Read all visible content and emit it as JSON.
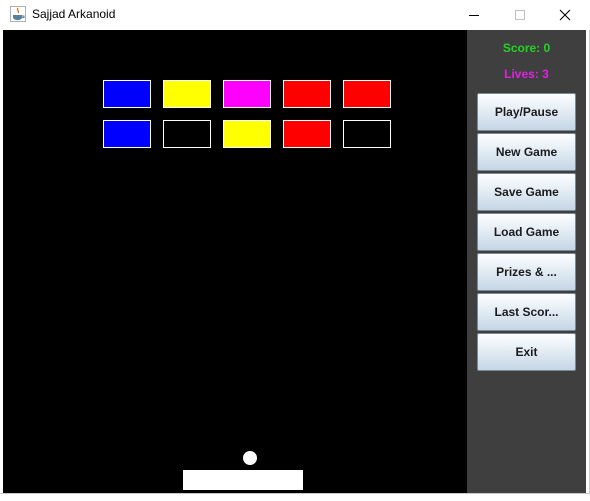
{
  "window": {
    "title": "Sajjad Arkanoid",
    "icons": {
      "app": "java-cup-icon",
      "minimize": "minimize-icon",
      "maximize": "maximize-icon",
      "close": "close-icon"
    }
  },
  "sidebar": {
    "score": "Score: 0",
    "lives": "Lives: 3",
    "buttons": [
      {
        "name": "play-pause-button",
        "label": "Play/Pause"
      },
      {
        "name": "new-game-button",
        "label": "New Game"
      },
      {
        "name": "save-game-button",
        "label": "Save Game"
      },
      {
        "name": "load-game-button",
        "label": "Load Game"
      },
      {
        "name": "prizes-button",
        "label": "Prizes & ..."
      },
      {
        "name": "last-scores-button",
        "label": "Last Scor..."
      },
      {
        "name": "exit-button",
        "label": "Exit"
      }
    ]
  },
  "board": {
    "background": "#000000",
    "bricks": [
      [
        "#0000ff",
        "#ffff00",
        "#ff00ff",
        "#ff0000",
        "#ff0000"
      ],
      [
        "#0000ff",
        "#000000",
        "#ffff00",
        "#ff0000",
        "#000000"
      ]
    ],
    "paddle_color": "#ffffff",
    "ball_color": "#ffffff"
  },
  "colors": {
    "score": "#22d422",
    "lives": "#e022e0",
    "sidebar_bg": "#3f3f3f"
  }
}
